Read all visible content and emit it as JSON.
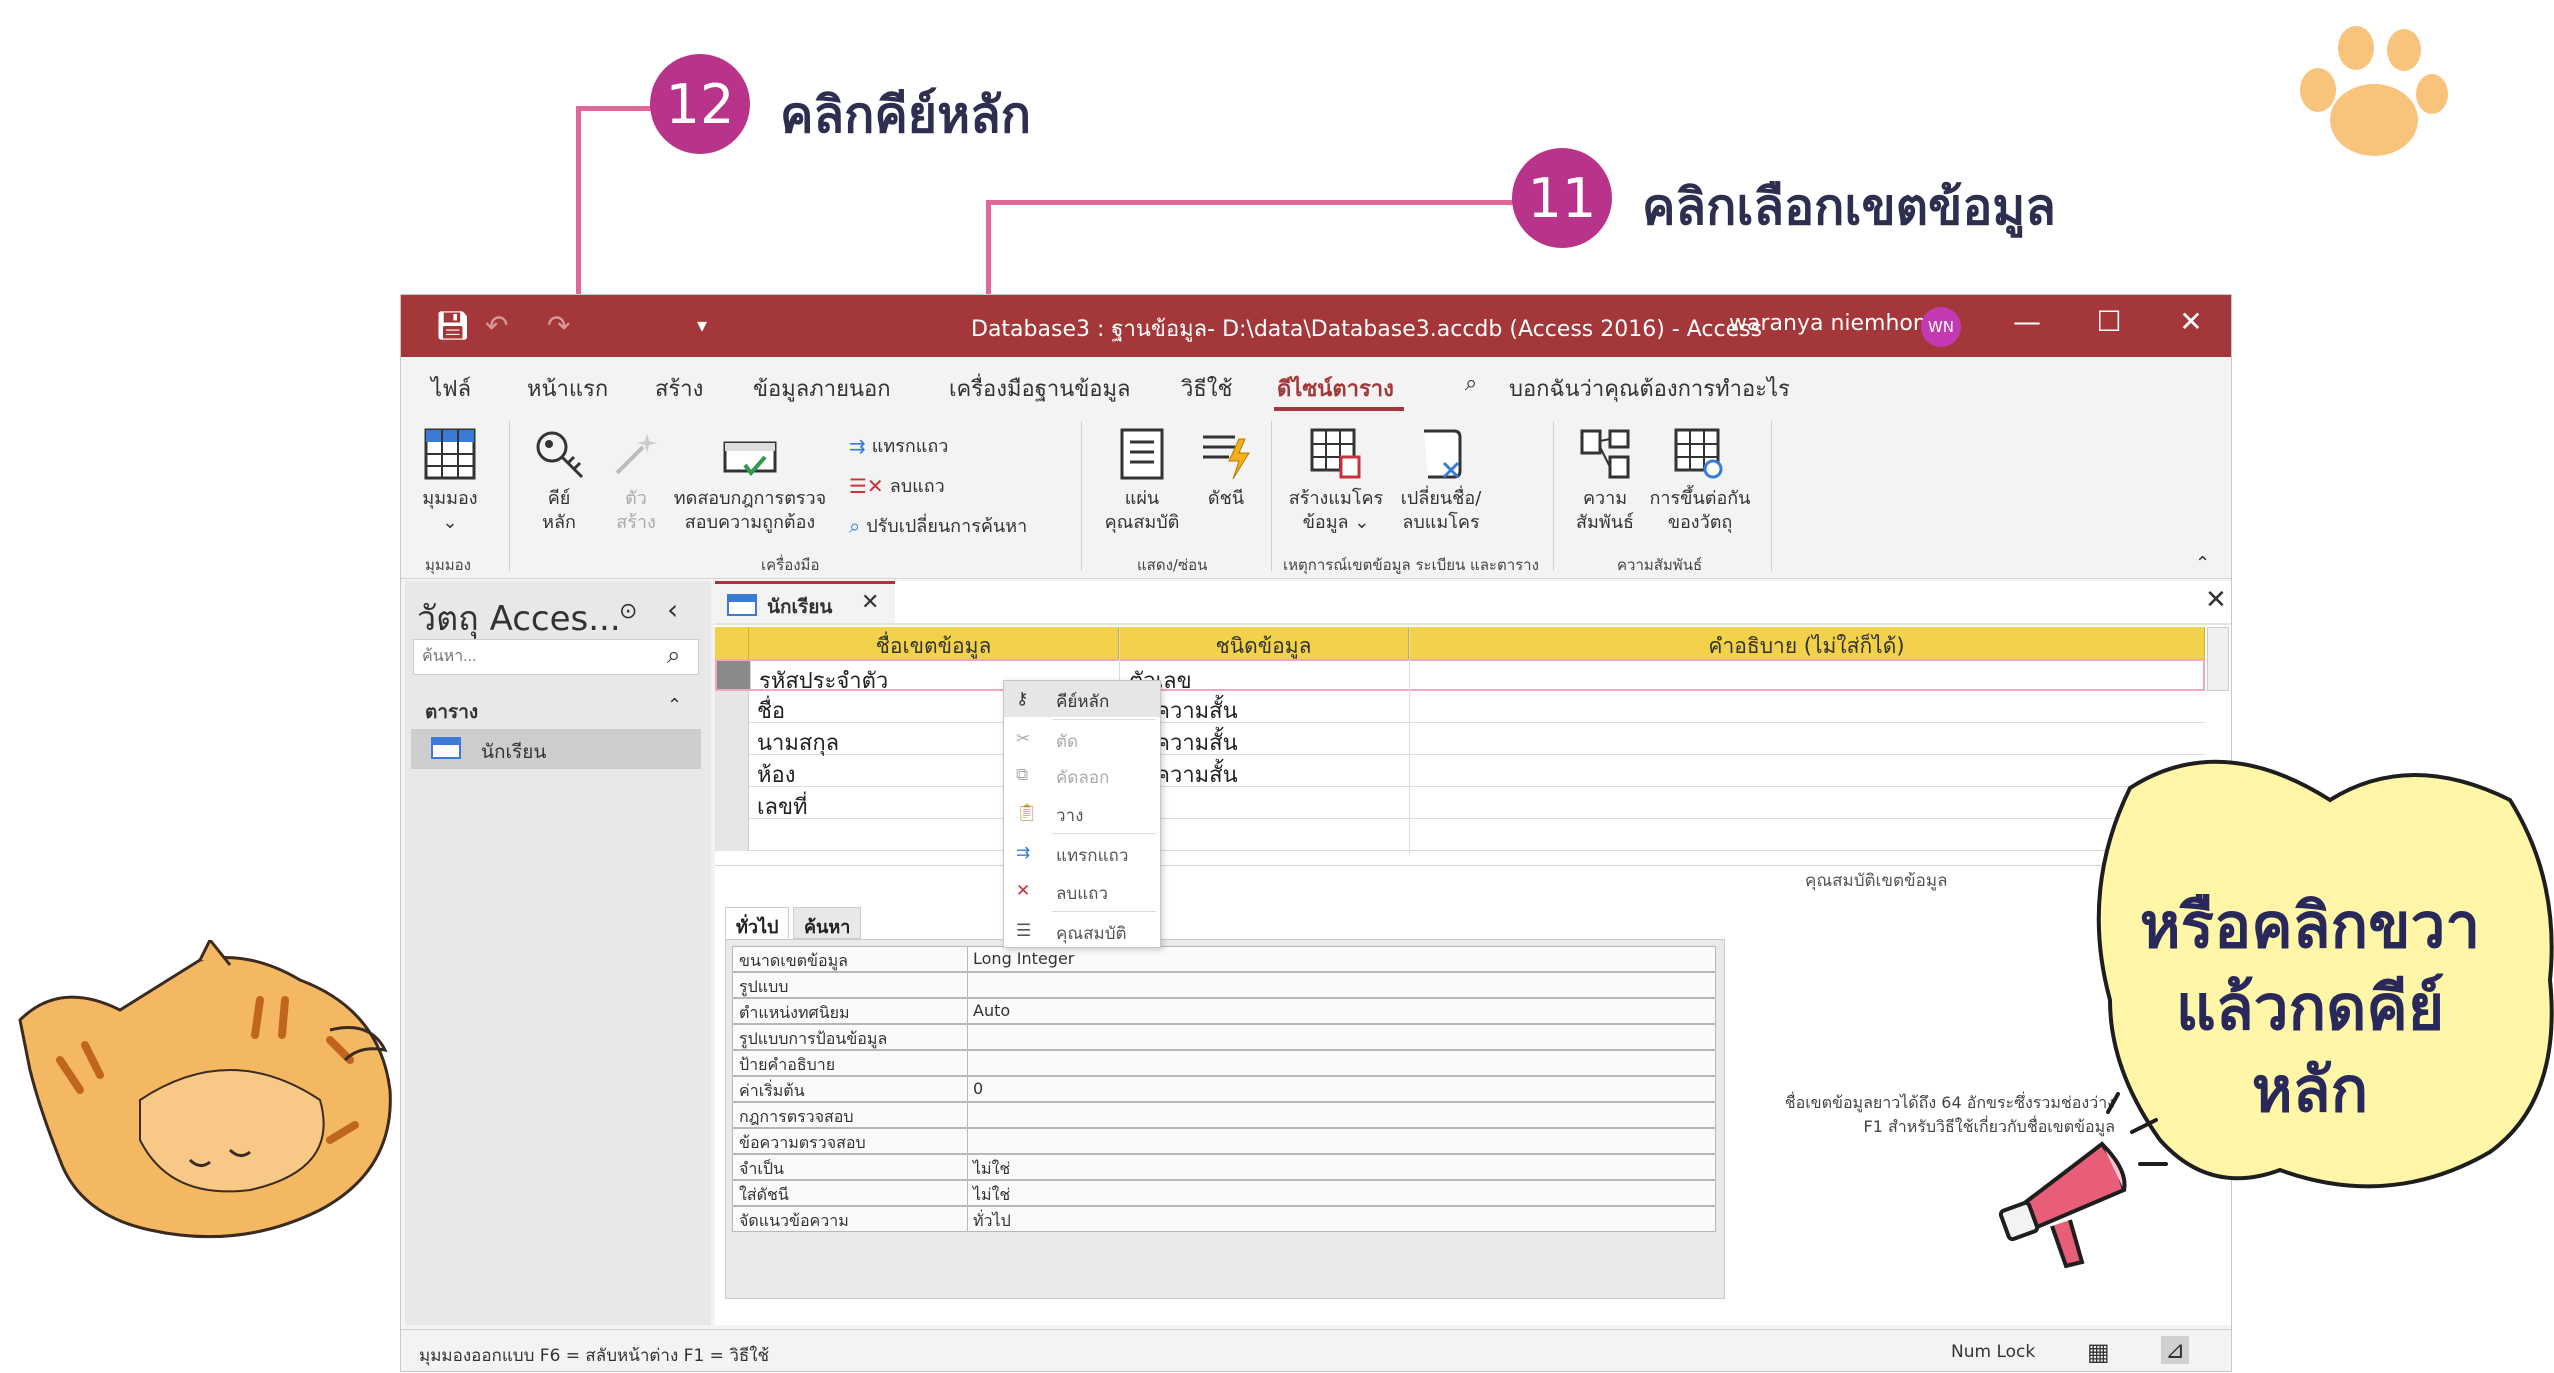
{
  "callouts": {
    "step12": {
      "number": "12",
      "text": "คลิกคีย์หลัก"
    },
    "step11": {
      "number": "11",
      "text": "คลิกเลือกเขตข้อมูล"
    },
    "bubble": {
      "line1": "หรือคลิกขวา",
      "line2": "แล้วกดคีย์",
      "line3": "หลัก"
    }
  },
  "window": {
    "title": "Database3 : ฐานข้อมูล- D:\\data\\Database3.accdb (Access 2016)  -  Access",
    "user": "waranya niemhom",
    "initials": "WN",
    "accent": "#a4373a"
  },
  "tabs": [
    "ไฟล์",
    "หน้าแรก",
    "สร้าง",
    "ข้อมูลภายนอก",
    "เครื่องมือฐานข้อมูล",
    "วิธีใช้",
    "ดีไซน์ตาราง"
  ],
  "tell_me": "บอกฉันว่าคุณต้องการทำอะไร",
  "ribbon": {
    "view": {
      "line1": "มุมมอง",
      "line2": "⌄"
    },
    "primary_key": {
      "line1": "คีย์",
      "line2": "หลัก"
    },
    "builder": {
      "line1": "ตัว",
      "line2": "สร้าง"
    },
    "test_rules": {
      "line1": "ทดสอบกฎการตรวจ",
      "line2": "สอบความถูกต้อง"
    },
    "insert_rows": "แทรกแถว",
    "delete_rows": "ลบแถว",
    "modify_lookups": "ปรับเปลี่ยนการค้นหา",
    "property_sheet": {
      "line1": "แผ่น",
      "line2": "คุณสมบัติ"
    },
    "indexes": {
      "line1": "ดัชนี",
      "line2": ""
    },
    "create_macros": {
      "line1": "สร้างแมโคร",
      "line2": "ข้อมูล ⌄"
    },
    "rename_macro": {
      "line1": "เปลี่ยนชื่อ/",
      "line2": "ลบแมโคร"
    },
    "relationships": {
      "line1": "ความ",
      "line2": "สัมพันธ์"
    },
    "dependencies": {
      "line1": "การขึ้นต่อกัน",
      "line2": "ของวัตถุ"
    },
    "groups": {
      "views": "มุมมอง",
      "tools": "เครื่องมือ",
      "show_hide": "แสดง/ซ่อน",
      "events": "เหตุการณ์เขตข้อมูล ระเบียน และตาราง",
      "relationships": "ความสัมพันธ์"
    }
  },
  "nav": {
    "title": "วัตถุ Acces...",
    "search_placeholder": "ค้นหา...",
    "category": "ตาราง",
    "item": "นักเรียน"
  },
  "doc": {
    "tab_label": "นักเรียน",
    "headers": [
      "ชื่อเขตข้อมูล",
      "ชนิดข้อมูล",
      "คำอธิบาย (ไม่ใส่ก็ได้)"
    ],
    "rows": [
      {
        "field": "รหัสประจำตัว",
        "type": "ตัวเลข"
      },
      {
        "field": "ชื่อ",
        "type": "ข้อความสั้น"
      },
      {
        "field": "นามสกุล",
        "type": "ข้อความสั้น"
      },
      {
        "field": "ห้อง",
        "type": "ข้อความสั้น"
      },
      {
        "field": "เลขที่",
        "type": ""
      }
    ],
    "properties_label": "คุณสมบัติเขตข้อมูล"
  },
  "context_menu": [
    "คีย์หลัก",
    "ตัด",
    "คัดลอก",
    "วาง",
    "แทรกแถว",
    "ลบแถว",
    "คุณสมบัติ"
  ],
  "props": {
    "tabs": [
      "ทั่วไป",
      "ค้นหา"
    ],
    "rows": [
      {
        "k": "ขนาดเขตข้อมูล",
        "v": "Long Integer"
      },
      {
        "k": "รูปแบบ",
        "v": ""
      },
      {
        "k": "ตำแหน่งทศนิยม",
        "v": "Auto"
      },
      {
        "k": "รูปแบบการป้อนข้อมูล",
        "v": ""
      },
      {
        "k": "ป้ายคำอธิบาย",
        "v": ""
      },
      {
        "k": "ค่าเริ่มต้น",
        "v": "0"
      },
      {
        "k": "กฎการตรวจสอบ",
        "v": ""
      },
      {
        "k": "ข้อความตรวจสอบ",
        "v": ""
      },
      {
        "k": "จำเป็น",
        "v": "ไม่ใช่"
      },
      {
        "k": "ใส่ดัชนี",
        "v": "ไม่ใช่"
      },
      {
        "k": "จัดแนวข้อความ",
        "v": "ทั่วไป"
      }
    ],
    "help_line1": "ชื่อเขตข้อมูลยาวได้ถึง 64 อักขระซึ่งรวมช่องว่าง",
    "help_line2": "F1 สำหรับวิธีใช้เกี่ยวกับชื่อเขตข้อมูล"
  },
  "status": {
    "left": "มุมมองออกแบบ  F6 = สลับหน้าต่าง  F1 = วิธีใช้",
    "num_lock": "Num Lock"
  }
}
